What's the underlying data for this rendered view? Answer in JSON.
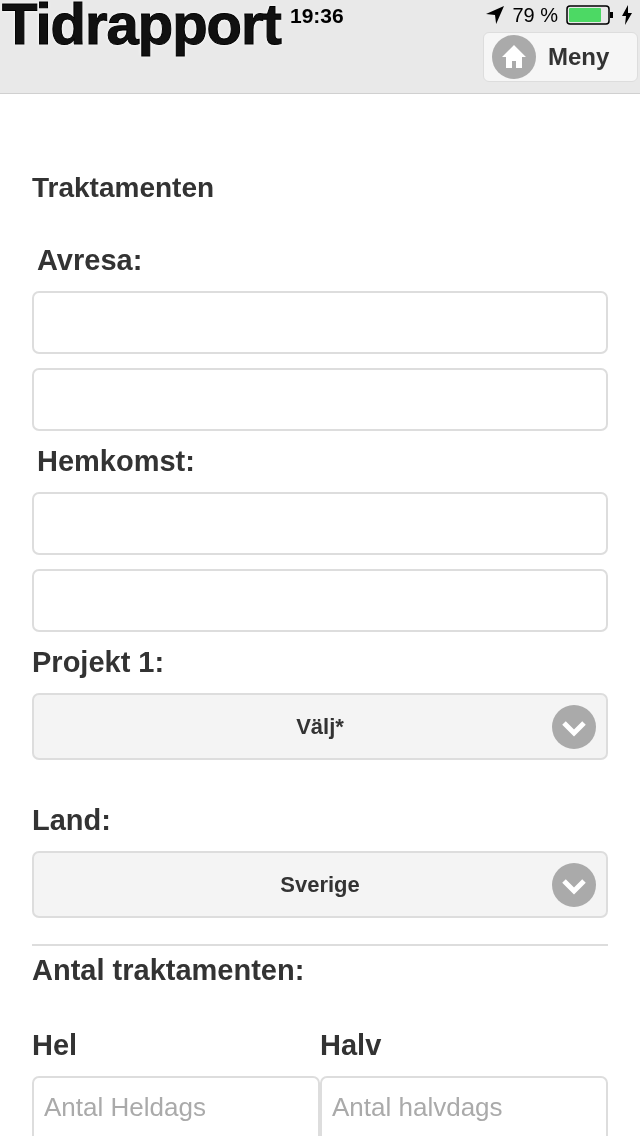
{
  "status_bar": {
    "time": "19:36",
    "battery": "79 %"
  },
  "header": {
    "title": "Tidrapport",
    "menu_button": "Meny"
  },
  "heading": "Traktamenten",
  "fields": [
    {
      "kind": "date_pair",
      "label": "Avresa:"
    },
    {
      "kind": "date_pair",
      "label": "Hemkomst:"
    },
    {
      "kind": "select",
      "label": "Projekt 1:",
      "value": "Välj*"
    },
    {
      "kind": "select",
      "label": "Land:",
      "value": "Sverige"
    }
  ],
  "count_section": {
    "heading": "Antal traktamenten:",
    "columns": [
      {
        "label": "Hel",
        "placeholder": "Antal Heldags"
      },
      {
        "label": "Halv",
        "placeholder": "Antal halvdags"
      }
    ]
  }
}
